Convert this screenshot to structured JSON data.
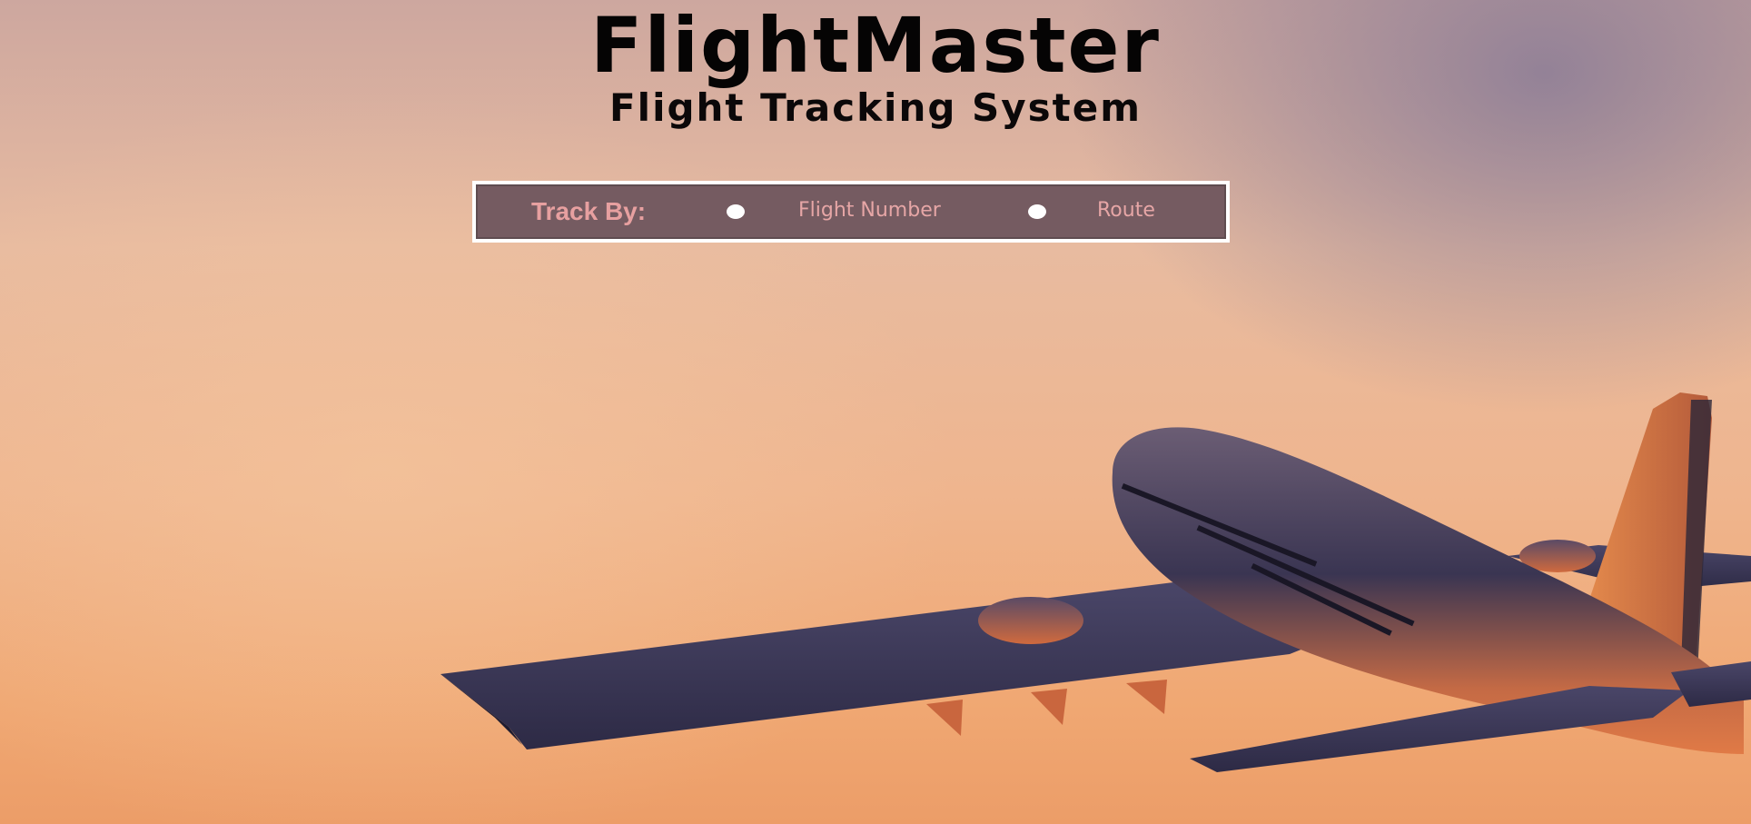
{
  "header": {
    "title": "FlightMaster",
    "subtitle": "Flight Tracking System"
  },
  "track_by": {
    "label": "Track By:",
    "options": [
      {
        "label": "Flight Number",
        "selected": false
      },
      {
        "label": "Route",
        "selected": false
      }
    ]
  },
  "background": {
    "image": "airplane-taking-off-at-sunset",
    "sky_colors": [
      "#cda79f",
      "#e8bba0",
      "#f0a873"
    ],
    "plane_body_color": "#3b3550"
  },
  "colors": {
    "panel_background": "#755b61",
    "panel_border": "#ffffff",
    "label_text": "#e7a0a0",
    "title_text": "#050404"
  }
}
